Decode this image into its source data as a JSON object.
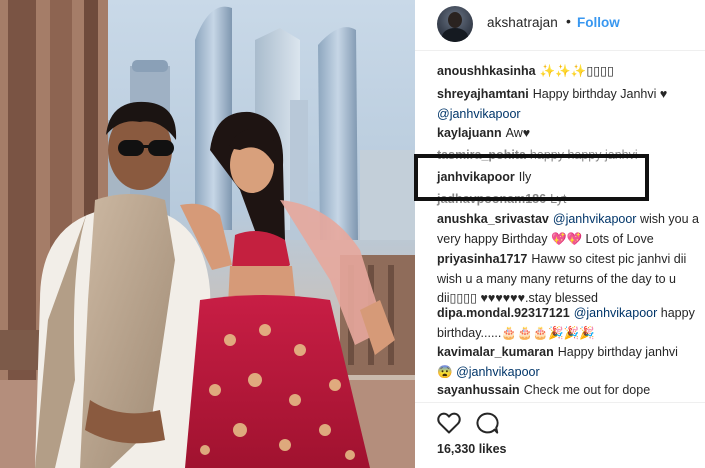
{
  "post": {
    "username": "akshatrajan",
    "separator": "•",
    "follow_label": "Follow"
  },
  "comments": [
    {
      "user": "anoushhkasinha",
      "text": "✨✨✨▯▯▯▯"
    },
    {
      "user": "shreyajhamtani",
      "text": "Happy birthday Janhvi ♥",
      "mention": "@janhvikapoor"
    },
    {
      "user": "kaylajuann",
      "text": "Aw♥"
    },
    {
      "user": "tasmira_pohita",
      "text": "happy happy janhvi"
    },
    {
      "user": "janhvikapoor",
      "text": "Ily"
    },
    {
      "user": "jadhavpoonam186",
      "text": "Lyt"
    },
    {
      "user": "anushka_srivastav",
      "mention": "@janhvikapoor",
      "text": "wish you a very happy Birthday 💖💖 Lots of Love"
    },
    {
      "user": "priyasinha1717",
      "text": "Haww so citest pic janhvi dii wish u a many many returns of the day to u dii▯▯▯▯ ♥♥♥♥♥♥.stay blessed"
    },
    {
      "user": "dipa.mondal.92317121",
      "mention": "@janhvikapoor",
      "text": "happy birthday......🎂🎂🎂🎉🎉🎉"
    },
    {
      "user": "kavimalar_kumaran",
      "text": "Happy birthday janhvi",
      "mention": "@janhvikapoor",
      "emoji": "😨"
    },
    {
      "user": "sayanhussain",
      "text": "Check me out for dope"
    }
  ],
  "actions": {
    "like_icon": "heart-icon",
    "comment_icon": "speech-bubble-icon"
  },
  "likes_label": "16,330 likes",
  "colors": {
    "link_blue": "#3897f0",
    "mention_blue": "#003569",
    "text": "#262626"
  }
}
